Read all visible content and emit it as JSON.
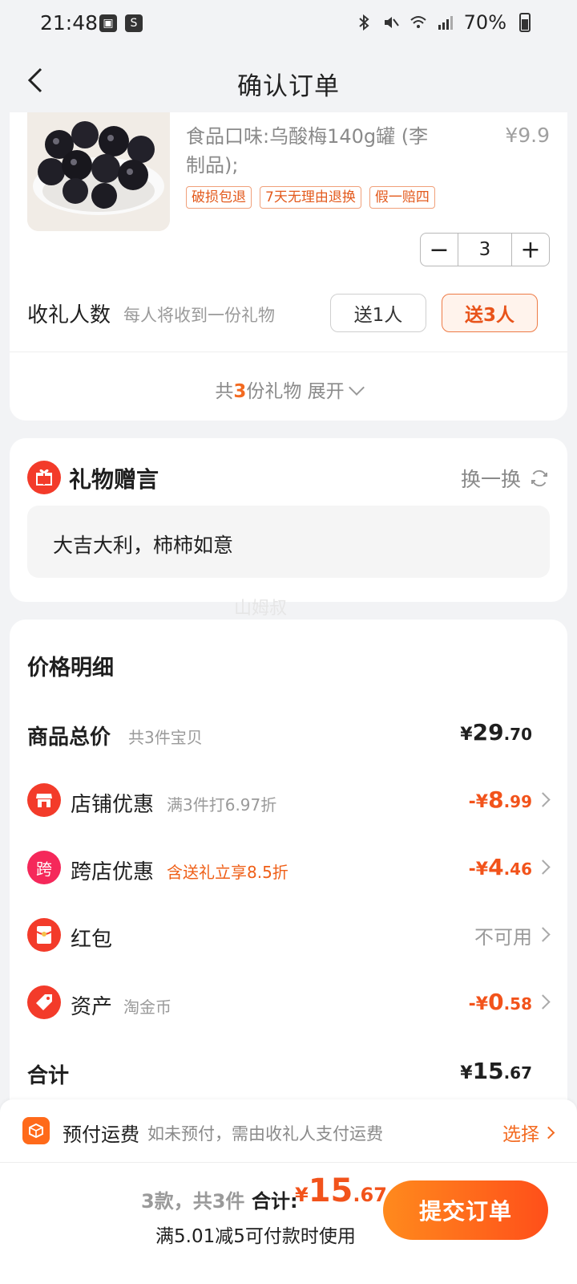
{
  "status_bar": {
    "time": "21:48",
    "battery": "70%"
  },
  "header": {
    "title": "确认订单",
    "back_icon": "chevron-left-icon"
  },
  "product": {
    "flavor": "食品口味:乌酸梅140g罐 (李制品);",
    "price": "¥9.9",
    "tags": [
      "破损包退",
      "7天无理由退换",
      "假一赔四"
    ],
    "quantity": "3",
    "minus_label": "−",
    "plus_label": "+"
  },
  "recipients": {
    "label": "收礼人数",
    "hint": "每人将收到一份礼物",
    "option_1": "送1人",
    "option_3": "送3人",
    "selected": "送3人"
  },
  "expand": {
    "prefix": "共",
    "count": "3",
    "suffix": "份礼物 展开"
  },
  "gift_message": {
    "title": "礼物赠言",
    "swap_label": "换一换",
    "message": "大吉大利，柿柿如意"
  },
  "watermark": "山姆叔",
  "price_detail": {
    "title": "价格明细",
    "goods_total": {
      "label": "商品总价",
      "sub": "共3件宝贝",
      "yen": "¥",
      "int": "29",
      "dec": ".70"
    },
    "shop_discount": {
      "label": "店铺优惠",
      "sub": "满3件打6.97折",
      "prefix": "-¥",
      "int": "8",
      "dec": ".99"
    },
    "cross_discount": {
      "label": "跨店优惠",
      "icon_text": "跨",
      "sub": "含送礼立享8.5折",
      "prefix": "-¥",
      "int": "4",
      "dec": ".46"
    },
    "red_packet": {
      "label": "红包",
      "value": "不可用"
    },
    "assets": {
      "label": "资产",
      "sub": "淘金币",
      "prefix": "-¥",
      "int": "0",
      "dec": ".58"
    },
    "total": {
      "label": "合计",
      "yen": "¥",
      "int": "15",
      "dec": ".67"
    }
  },
  "shipping": {
    "label": "预付运费",
    "hint": "如未预付，需由收礼人支付运费",
    "action": "选择"
  },
  "footer": {
    "count": "3款，共3件",
    "total_label": "合计:",
    "yen": "¥",
    "int": "15",
    "dec": ".67",
    "promo": "满5.01减5可付款时使用",
    "submit": "提交订单"
  },
  "colors": {
    "accent": "#f36a20",
    "price_red": "#f2531b",
    "icon_red": "#f33b2a"
  }
}
